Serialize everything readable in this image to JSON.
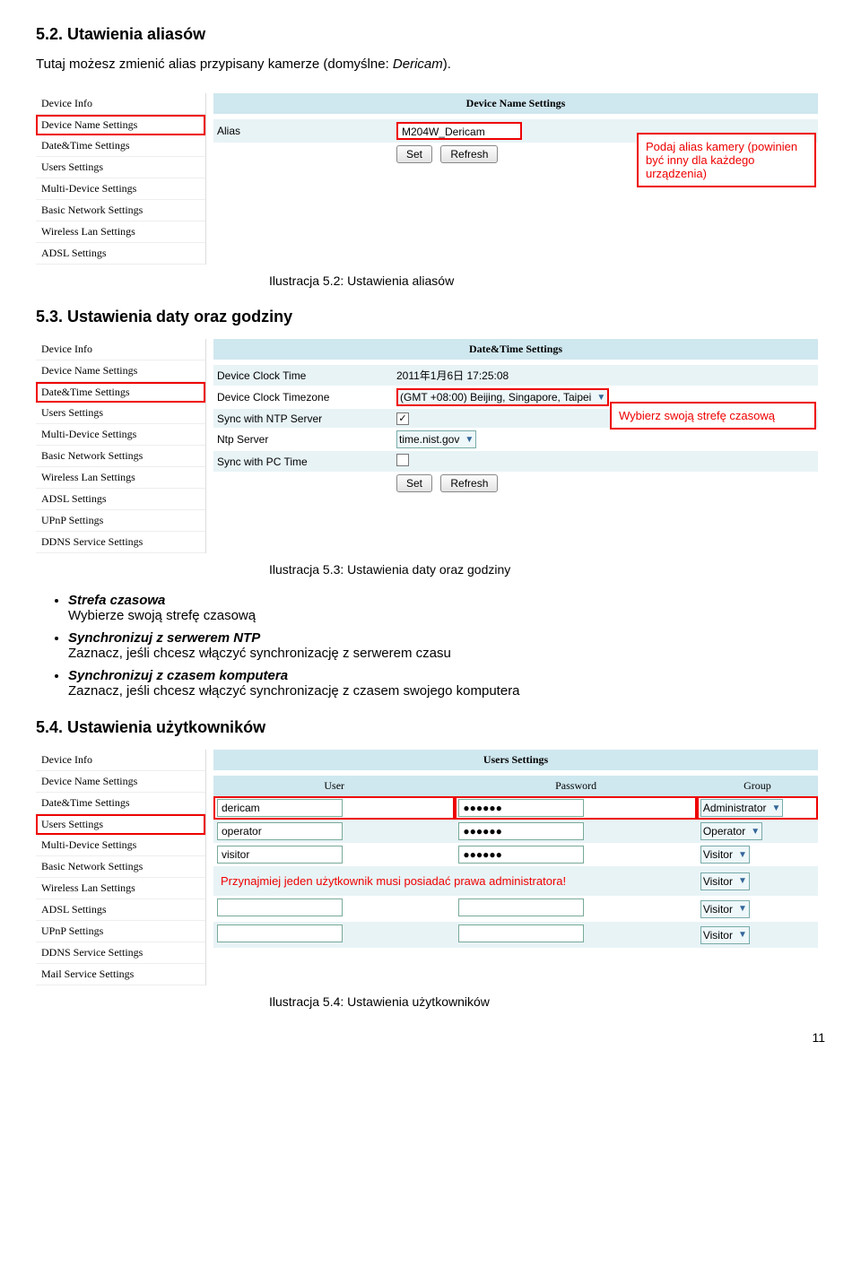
{
  "doc": {
    "sec52_title": "5.2. Utawienia aliasów",
    "sec52_body_a": "Tutaj możesz zmienić alias przypisany kamerze (domyślne: ",
    "sec52_body_b": "Dericam",
    "sec52_body_c": ").",
    "caption52": "Ilustracja 5.2: Ustawienia aliasów",
    "sec53_title": "5.3. Ustawienia daty oraz godziny",
    "caption53": "Ilustracja 5.3: Ustawienia daty oraz godziny",
    "bullets": {
      "b1_t": "Strefa czasowa",
      "b1_d": "Wybierze swoją strefę czasową",
      "b2_t": "Synchronizuj z serwerem NTP",
      "b2_d": "Zaznacz, jeśli chcesz włączyć synchronizację z serwerem czasu",
      "b3_t": "Synchronizuj z czasem komputera",
      "b3_d": "Zaznacz, jeśli chcesz włączyć synchronizację z czasem swojego komputera"
    },
    "sec54_title": "5.4. Ustawienia użytkowników",
    "caption54": "Ilustracja 5.4: Ustawienia użytkowników",
    "page_num": "11"
  },
  "sidebar_common": {
    "i0": "Device Info",
    "i1": "Device Name Settings",
    "i2": "Date&Time Settings",
    "i3": "Users Settings",
    "i4": "Multi-Device Settings",
    "i5": "Basic Network Settings",
    "i6": "Wireless Lan Settings",
    "i7": "ADSL Settings",
    "i8": "UPnP Settings",
    "i9": "DDNS Service Settings",
    "i10": "Mail Service Settings"
  },
  "scr52": {
    "header": "Device Name Settings",
    "alias_lbl": "Alias",
    "alias_val": "M204W_Dericam",
    "set_btn": "Set",
    "refresh_btn": "Refresh",
    "callout": "Podaj alias kamery (powinien być inny dla każdego urządzenia)"
  },
  "scr53": {
    "header": "Date&Time Settings",
    "r1_lbl": "Device Clock Time",
    "r1_val": "2011年1月6日   17:25:08",
    "r2_lbl": "Device Clock Timezone",
    "r2_val": "(GMT +08:00) Beijing, Singapore, Taipei",
    "r3_lbl": "Sync with NTP Server",
    "r4_lbl": "Ntp Server",
    "r4_val": "time.nist.gov",
    "r5_lbl": "Sync with PC Time",
    "set_btn": "Set",
    "refresh_btn": "Refresh",
    "callout": "Wybierz swoją strefę czasową"
  },
  "scr54": {
    "header": "Users Settings",
    "col_user": "User",
    "col_pwd": "Password",
    "col_group": "Group",
    "pwd_mask": "●●●●●●",
    "rows": {
      "r0_user": "dericam",
      "r0_group": "Administrator",
      "r1_user": "operator",
      "r1_group": "Operator",
      "r2_user": "visitor",
      "r2_group": "Visitor",
      "r3_user": "",
      "r3_group": "Visitor",
      "r4_user": "",
      "r4_group": "Visitor",
      "r5_user": "",
      "r5_group": "Visitor"
    },
    "admin_note": "Przynajmiej jeden użytkownik musi posiadać prawa administratora!"
  }
}
